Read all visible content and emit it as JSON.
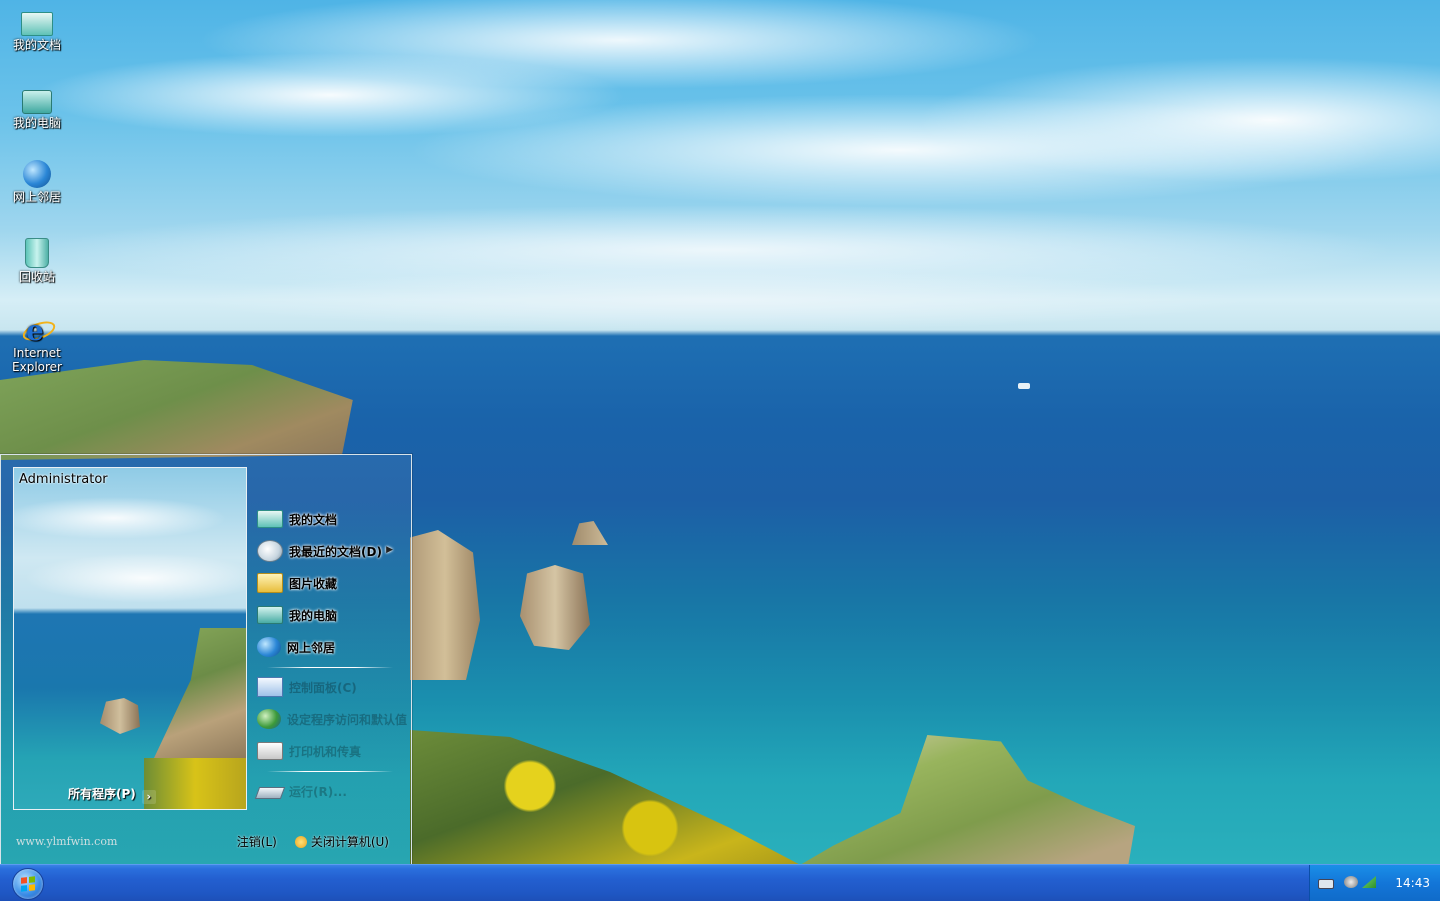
{
  "desktop": {
    "icons": [
      {
        "label": "我的文档",
        "icon": "my-documents-icon"
      },
      {
        "label": "我的电脑",
        "icon": "my-computer-icon"
      },
      {
        "label": "网上邻居",
        "icon": "network-places-icon"
      },
      {
        "label": "回收站",
        "icon": "recycle-bin-icon"
      },
      {
        "label": "Internet Explorer",
        "icon": "internet-explorer-icon"
      }
    ]
  },
  "start_menu": {
    "user_name": "Administrator",
    "all_programs": "所有程序(P)",
    "places": [
      {
        "label": "我的文档",
        "icon": "my-documents-icon"
      },
      {
        "label": "我最近的文档(D)",
        "icon": "recent-documents-icon",
        "has_submenu": true
      },
      {
        "label": "图片收藏",
        "icon": "my-pictures-icon"
      },
      {
        "label": "我的电脑",
        "icon": "my-computer-icon"
      },
      {
        "label": "网上邻居",
        "icon": "network-places-icon"
      }
    ],
    "system_items": [
      {
        "label": "控制面板(C)",
        "icon": "control-panel-icon"
      },
      {
        "label": "设定程序访问和默认值",
        "icon": "program-defaults-icon"
      },
      {
        "label": "打印机和传真",
        "icon": "printers-faxes-icon"
      }
    ],
    "run_item": {
      "label": "运行(R)...",
      "icon": "run-icon"
    },
    "watermark": "www.ylmfwin.com",
    "log_off": "注销(L)",
    "shut_down": "关闭计算机(U)"
  },
  "taskbar": {
    "start_icon": "windows-orb-icon",
    "tray_icons": [
      "keyboard-icon",
      "volume-icon",
      "network-icon"
    ],
    "clock": "14:43",
    "color": "#245edb"
  }
}
